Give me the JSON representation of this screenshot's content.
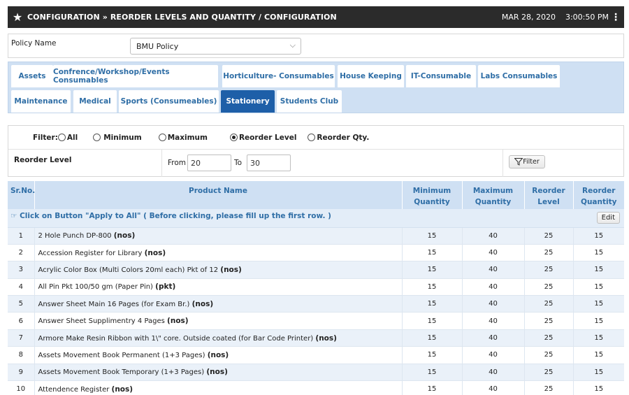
{
  "header": {
    "title": "CONFIGURATION » REORDER LEVELS AND QUANTITY / CONFIGURATION",
    "date": "MAR 28, 2020",
    "time": "3:00:50 PM"
  },
  "policy": {
    "label": "Policy Name",
    "selected": "BMU Policy"
  },
  "tabs": [
    {
      "label": "Assets"
    },
    {
      "label": "Confrence/Workshop/Events Consumables"
    },
    {
      "label": "Horticulture- Consumables"
    },
    {
      "label": "House Keeping"
    },
    {
      "label": "IT-Consumable"
    },
    {
      "label": "Labs Consumables"
    },
    {
      "label": "Maintenance"
    },
    {
      "label": "Medical"
    },
    {
      "label": "Sports (Consumeables)"
    },
    {
      "label": "Stationery",
      "active": true
    },
    {
      "label": "Students Club"
    }
  ],
  "filter": {
    "label": "Filter:",
    "options": [
      "All",
      "Minimum",
      "Maximum",
      "Reorder Level",
      "Reorder Qty."
    ],
    "selected": "Reorder Level",
    "range_label": "Reorder Level",
    "from_label": "From",
    "from_value": "20",
    "to_label": "To",
    "to_value": "30",
    "button_label": "Filter"
  },
  "table": {
    "headers": {
      "srno": "Sr.No.",
      "product": "Product Name",
      "min1": "Minimum",
      "min2": "Quantity",
      "max1": "Maximum",
      "max2": "Quantity",
      "rl1": "Reorder",
      "rl2": "Level",
      "rq1": "Reorder",
      "rq2": "Quantity"
    },
    "apply_text": "Click on Button \"Apply to All\" ( Before clicking, please fill up the first row. )",
    "edit_label": "Edit",
    "rows": [
      {
        "sn": "1",
        "name": "2 Hole Punch DP-800",
        "unit": "(nos)",
        "min": "15",
        "max": "40",
        "rl": "25",
        "rq": "15"
      },
      {
        "sn": "2",
        "name": "Accession Register for Library",
        "unit": "(nos)",
        "min": "15",
        "max": "40",
        "rl": "25",
        "rq": "15"
      },
      {
        "sn": "3",
        "name": "Acrylic Color Box (Multi Colors 20ml each) Pkt of 12",
        "unit": "(nos)",
        "min": "15",
        "max": "40",
        "rl": "25",
        "rq": "15"
      },
      {
        "sn": "4",
        "name": "All Pin Pkt 100/50 gm (Paper Pin)",
        "unit": "(pkt)",
        "min": "15",
        "max": "40",
        "rl": "25",
        "rq": "15"
      },
      {
        "sn": "5",
        "name": "Answer Sheet Main 16 Pages (for Exam Br.)",
        "unit": "(nos)",
        "min": "15",
        "max": "40",
        "rl": "25",
        "rq": "15"
      },
      {
        "sn": "6",
        "name": "Answer Sheet Supplimentry 4 Pages",
        "unit": "(nos)",
        "min": "15",
        "max": "40",
        "rl": "25",
        "rq": "15"
      },
      {
        "sn": "7",
        "name": "Armore Make Resin Ribbon with 1\\\" core. Outside coated (for Bar Code Printer)",
        "unit": "(nos)",
        "min": "15",
        "max": "40",
        "rl": "25",
        "rq": "15"
      },
      {
        "sn": "8",
        "name": "Assets Movement Book Permanent (1+3 Pages)",
        "unit": "(nos)",
        "min": "15",
        "max": "40",
        "rl": "25",
        "rq": "15"
      },
      {
        "sn": "9",
        "name": "Assets Movement Book Temporary (1+3 Pages)",
        "unit": "(nos)",
        "min": "15",
        "max": "40",
        "rl": "25",
        "rq": "15"
      },
      {
        "sn": "10",
        "name": "Attendence Register",
        "unit": "(nos)",
        "min": "15",
        "max": "40",
        "rl": "25",
        "rq": "15"
      }
    ]
  },
  "icons": {
    "star": "star-icon",
    "kebab": "kebab-menu-icon",
    "chevron": "chevron-down-icon",
    "hand": "pointing-hand-icon",
    "funnel": "funnel-icon"
  },
  "colors": {
    "header_bg": "#2b2b2b",
    "accent_blue": "#2f6ea6",
    "tab_active": "#1e5fa8",
    "panel_blue": "#cfe0f3"
  }
}
